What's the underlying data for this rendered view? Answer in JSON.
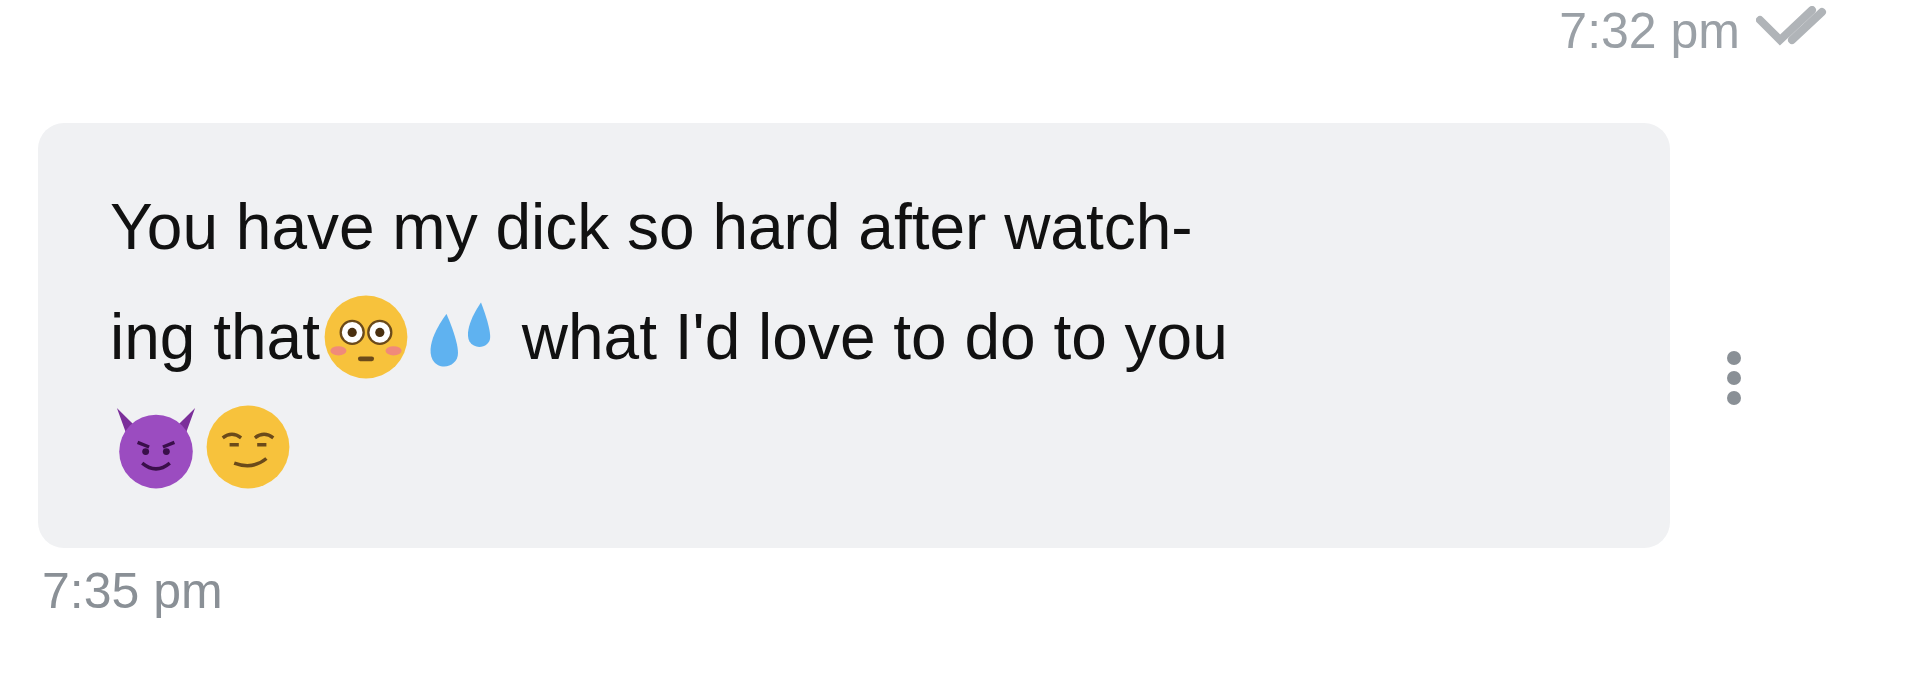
{
  "previous_message": {
    "time": "7:32 pm",
    "read": true
  },
  "message": {
    "lines": [
      [
        {
          "kind": "text",
          "text": "You have my dick so hard after watch-"
        }
      ],
      [
        {
          "kind": "text",
          "text": "ing that"
        },
        {
          "kind": "flushed"
        },
        {
          "kind": "sweat"
        },
        {
          "kind": "text",
          "text": " what I'd love to do to you"
        }
      ],
      [
        {
          "kind": "devil"
        },
        {
          "kind": "smirk"
        }
      ]
    ],
    "time": "7:35 pm"
  }
}
